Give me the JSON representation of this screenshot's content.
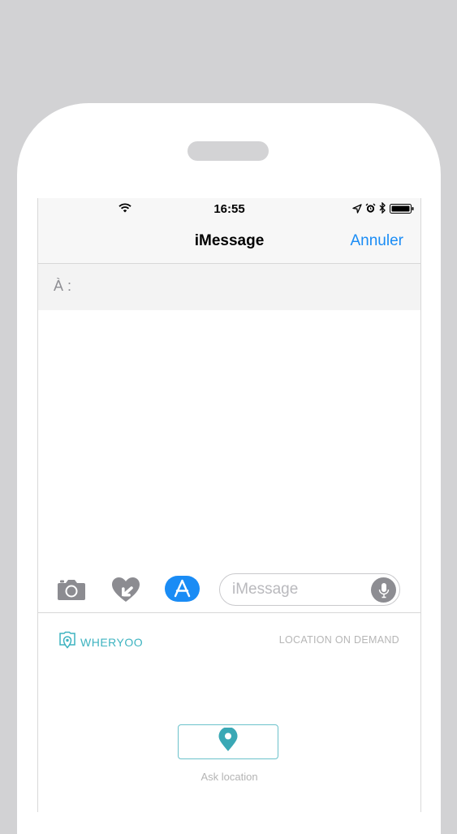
{
  "status_bar": {
    "time": "16:55"
  },
  "nav": {
    "title": "iMessage",
    "cancel_label": "Annuler"
  },
  "compose": {
    "to_label": "À :"
  },
  "toolbar": {
    "message_placeholder": "iMessage",
    "icons": [
      "camera-icon",
      "digital-touch-heart-icon",
      "app-store-icon",
      "microphone-icon"
    ]
  },
  "extension": {
    "brand_name": "WHERYOO",
    "tagline": "LOCATION ON DEMAND",
    "ask_button_label": "Ask location"
  },
  "colors": {
    "ios_blue": "#1a8cf5",
    "brand_teal": "#3db3c0",
    "background": "#d2d2d4"
  }
}
